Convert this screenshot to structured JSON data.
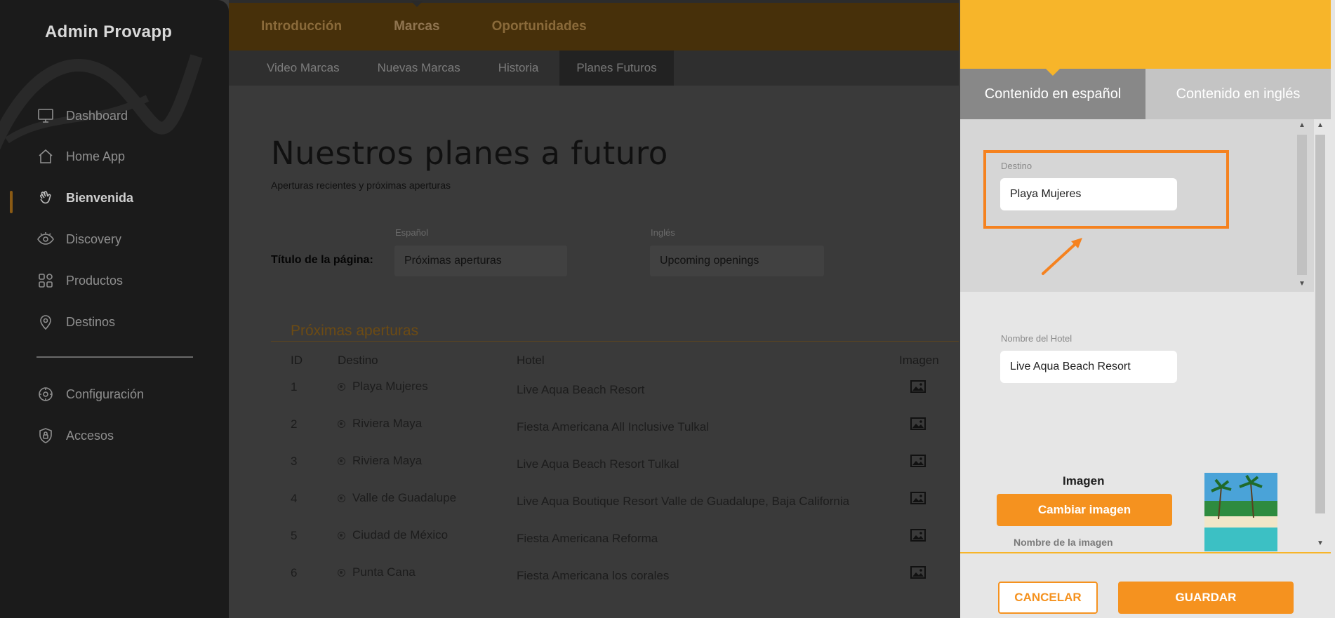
{
  "sidebar": {
    "brand": "Admin Provapp",
    "items": [
      {
        "label": "Dashboard",
        "icon": "monitor-icon"
      },
      {
        "label": "Home App",
        "icon": "home-icon"
      },
      {
        "label": "Bienvenida",
        "icon": "waving-hand-icon",
        "active": true
      },
      {
        "label": "Discovery",
        "icon": "eye-icon"
      },
      {
        "label": "Productos",
        "icon": "grid-icon"
      },
      {
        "label": "Destinos",
        "icon": "map-pin-icon"
      },
      {
        "label": "Configuración",
        "icon": "gear-icon"
      },
      {
        "label": "Accesos",
        "icon": "shield-lock-icon"
      }
    ]
  },
  "topnav": {
    "tabs": [
      "Introducción",
      "Marcas",
      "Oportunidades"
    ],
    "active": "Marcas"
  },
  "subnav": {
    "tabs": [
      "Video Marcas",
      "Nuevas Marcas",
      "Historia",
      "Planes Futuros"
    ],
    "active": "Planes Futuros"
  },
  "main": {
    "title": "Nuestros planes a futuro",
    "subtitle": "Aperturas recientes y próximas aperturas",
    "page_title_label": "Título de la página:",
    "lang_es_label": "Español",
    "lang_en_label": "Inglés",
    "title_es_value": "Próximas aperturas",
    "title_en_value": "Upcoming openings",
    "section_title": "Próximas aperturas",
    "table": {
      "headers": {
        "id": "ID",
        "destino": "Destino",
        "hotel": "Hotel",
        "imagen": "Imagen"
      },
      "rows": [
        {
          "id": "1",
          "destino": "Playa Mujeres",
          "hotel": "Live Aqua Beach Resort"
        },
        {
          "id": "2",
          "destino": "Riviera Maya",
          "hotel": "Fiesta Americana All Inclusive Tulkal"
        },
        {
          "id": "3",
          "destino": "Riviera Maya",
          "hotel": "Live Aqua Beach Resort Tulkal"
        },
        {
          "id": "4",
          "destino": "Valle de Guadalupe",
          "hotel": "Live Aqua Boutique Resort Valle de Guadalupe, Baja California"
        },
        {
          "id": "5",
          "destino": "Ciudad de México",
          "hotel": "Fiesta Americana Reforma"
        },
        {
          "id": "6",
          "destino": "Punta Cana",
          "hotel": "Fiesta Americana los corales"
        }
      ]
    }
  },
  "panel": {
    "tabs": [
      "Contenido en español",
      "Contenido en inglés"
    ],
    "active_tab": "Contenido en español",
    "destino_label": "Destino",
    "destino_value": "Playa Mujeres",
    "hotel_label": "Nombre del Hotel",
    "hotel_value": "Live Aqua Beach Resort",
    "image_title": "Imagen",
    "change_image": "Cambiar imagen",
    "image_name_label": "Nombre de la imagen",
    "cancel": "CANCELAR",
    "save": "GUARDAR"
  },
  "colors": {
    "accent": "#f5921f",
    "header_yellow": "#f7b52a",
    "sidebar_bg": "#1b1b1b",
    "overlay_gray": "#3a3a3a"
  }
}
